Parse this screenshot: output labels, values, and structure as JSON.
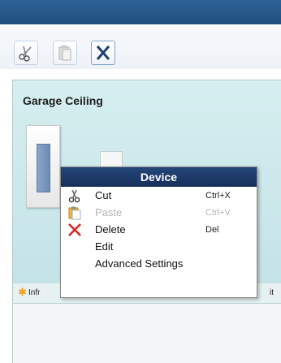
{
  "toolbar": {
    "cut_icon": "scissors-icon",
    "paste_icon": "clipboard-icon",
    "delete_icon": "x-icon"
  },
  "tile": {
    "title": "Garage Ceiling",
    "status_text": "Infr",
    "status_right": "it"
  },
  "context_menu": {
    "header": "Device",
    "items": [
      {
        "label": "Cut",
        "shortcut": "Ctrl+X",
        "icon": "scissors-icon",
        "enabled": true
      },
      {
        "label": "Paste",
        "shortcut": "Ctrl+V",
        "icon": "clipboard-icon",
        "enabled": false
      },
      {
        "label": "Delete",
        "shortcut": "Del",
        "icon": "red-x-icon",
        "enabled": true
      },
      {
        "label": "Edit",
        "shortcut": "",
        "icon": "",
        "enabled": true
      },
      {
        "label": "Advanced Settings",
        "shortcut": "",
        "icon": "",
        "enabled": true
      }
    ]
  },
  "colors": {
    "titlebar": "#2f6396",
    "menu_header": "#24477a",
    "tile_bg": "#d6eef0",
    "delete_red": "#d9261c",
    "star_orange": "#f3a01c"
  }
}
